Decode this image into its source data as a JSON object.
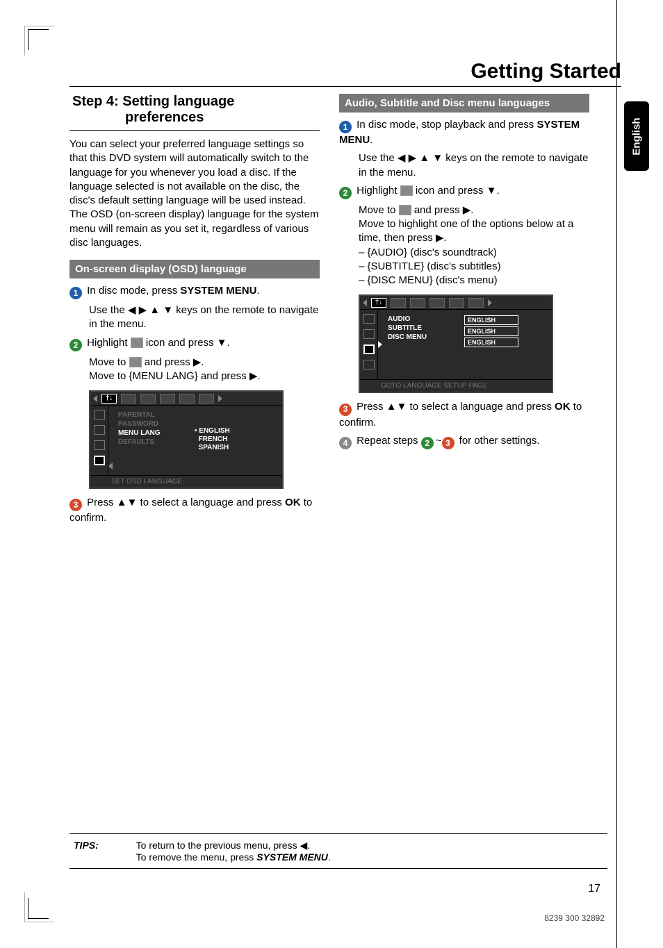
{
  "page_title": "Getting Started",
  "language_tab": "English",
  "step4": {
    "heading_line1": "Step 4:  Setting language",
    "heading_line2": "preferences",
    "intro": "You can select your preferred language settings so that this DVD system will automatically switch to the language for you whenever you load a disc.  If the language selected is not available on the disc, the disc's default setting language will be used instead.  The OSD (on-screen display) language for the system menu will remain as you set it, regardless of various disc languages."
  },
  "osd": {
    "banner": "On-screen display (OSD) language",
    "s1_a": "In disc mode, press ",
    "s1_b": "SYSTEM MENU",
    "s1_c": ".",
    "s1_sub": "Use the ◀ ▶ ▲ ▼ keys on the remote to navigate in the menu.",
    "s2_a": "Highlight ",
    "s2_b": " icon and press ▼.",
    "s2_sub_a": "Move to ",
    "s2_sub_b": " and press ▶.",
    "s2_sub_c": "Move to {MENU LANG} and press ▶.",
    "s3": "Press ▲▼ to select a language and press ",
    "s3_ok": "OK",
    "s3_end": " to confirm."
  },
  "osd_menu": {
    "items": [
      "PARENTAL",
      "PASSWORD",
      "MENU LANG",
      "DEFAULTS"
    ],
    "active_index": 2,
    "options": [
      "ENGLISH",
      "FRENCH",
      "SPANISH"
    ],
    "footer": "SET OSD LANGUAGE"
  },
  "audio": {
    "banner": "Audio, Subtitle and Disc menu languages",
    "s1_a": "In disc mode, stop playback and press ",
    "s1_b": "SYSTEM MENU",
    "s1_c": ".",
    "s1_sub": "Use the ◀ ▶ ▲ ▼ keys on the remote to navigate in the menu.",
    "s2_a": "Highlight ",
    "s2_b": " icon and press ▼.",
    "s2_sub_a": "Move to ",
    "s2_sub_b": " and press ▶.",
    "s2_sub_c": "Move to highlight one of the options below at a time, then press ▶.",
    "opts": [
      "{AUDIO} (disc's soundtrack)",
      "{SUBTITLE} (disc's subtitles)",
      "{DISC MENU} (disc's menu)"
    ],
    "s3": "Press ▲▼ to select a language and press ",
    "s3_ok": "OK",
    "s3_end": " to confirm.",
    "s4_a": "Repeat steps ",
    "s4_b": "~",
    "s4_c": " for other settings."
  },
  "audio_menu": {
    "items": [
      "AUDIO",
      "SUBTITLE",
      "DISC MENU"
    ],
    "values": [
      "ENGLISH",
      "ENGLISH",
      "ENGLISH"
    ],
    "footer": "GOTO LANGUAGE SETUP PAGE"
  },
  "tips": {
    "label": "TIPS:",
    "line1_a": "To return to the previous menu, press ◀.",
    "line2_a": "To remove the menu, press ",
    "line2_b": "SYSTEM MENU",
    "line2_c": "."
  },
  "page_number": "17",
  "part_number": "8239 300 32892"
}
